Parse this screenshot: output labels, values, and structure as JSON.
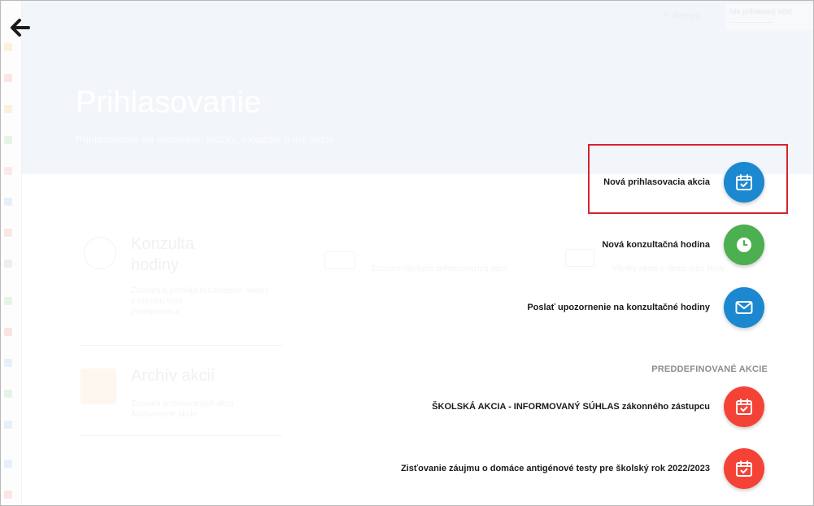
{
  "header": {
    "title": "Prihlasovanie",
    "subtitle": "Prihlasovanie na semináre, krúžky, exkurzie a iné akcie",
    "help_label": "Pomoc",
    "help_icon": "question-icon",
    "account_label": "Nie prihlásený účet"
  },
  "background_cards": {
    "consultation_title_line1": "Konzulta",
    "consultation_title_line2": "hodiny",
    "consultation_desc": [
      "Zoznam a prehľad konzultačné hodiny",
      "v rozvrhu tried",
      "zverejnenie a"
    ],
    "mid_desc": "Zoznam všetkých prihlasovacích akcií",
    "right_desc": "Všetky akcie v rámci tejto školy",
    "archive_title": "Archív akcií",
    "archive_desc": [
      "Zoznam archivovaných akcií",
      "Archivované akcie"
    ]
  },
  "actions": [
    {
      "label": "Nová prihlasovacia akcia",
      "icon": "calendar-check-icon",
      "color": "#1b88d0"
    },
    {
      "label": "Nová konzultačná hodina",
      "icon": "clock-icon",
      "color": "#4caf50"
    },
    {
      "label": "Poslať upozornenie na konzultačné hodiny",
      "icon": "envelope-icon",
      "color": "#1b88d0"
    }
  ],
  "predefined_heading": "PREDDEFINOVANÉ AKCIE",
  "predefined_actions": [
    {
      "label": "ŠKOLSKÁ AKCIA - INFORMOVANÝ SÚHLAS zákonného zástupcu",
      "icon": "calendar-check-icon",
      "color": "#f44336"
    },
    {
      "label": "Zisťovanie záujmu o domáce antigénové testy pre školský rok 2022/2023",
      "icon": "calendar-check-icon",
      "color": "#f44336"
    }
  ],
  "colors": {
    "highlight": "#d9232e",
    "hero_bg": "#f2f6fa"
  },
  "back_icon": "arrow-left-icon"
}
